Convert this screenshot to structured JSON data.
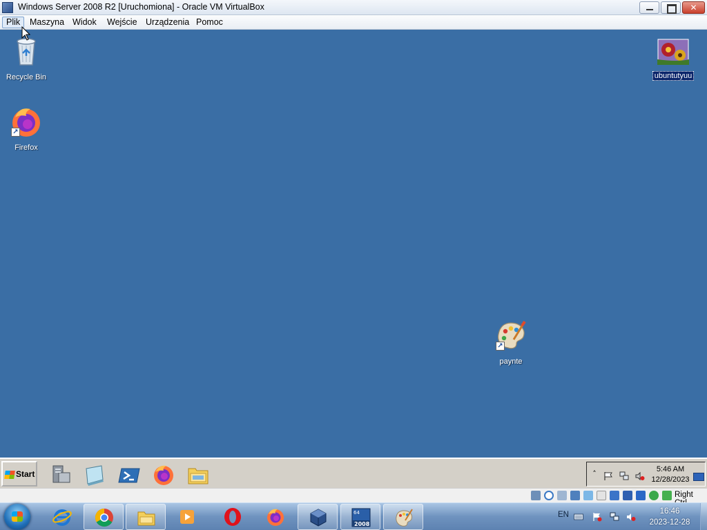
{
  "window": {
    "title": "Windows Server 2008 R2 [Uruchomiona] - Oracle VM VirtualBox",
    "icon": "virtualbox-icon"
  },
  "menu": {
    "items": [
      "Plik",
      "Maszyna",
      "Widok",
      "Wejście",
      "Urządzenia",
      "Pomoc"
    ],
    "active": "Plik"
  },
  "desktop": {
    "background_color": "#3a6ea5",
    "icons": {
      "recycle_bin": {
        "label": "Recycle Bin",
        "icon": "recycle-bin-icon"
      },
      "firefox": {
        "label": "Firefox",
        "icon": "firefox-icon"
      },
      "ubuntutyuu": {
        "label": "ubuntutyuu",
        "icon": "image-file-icon",
        "selected": true
      },
      "paynte": {
        "label": "paynte",
        "icon": "paint-palette-icon"
      }
    }
  },
  "guest_taskbar": {
    "start_label": "Start",
    "quicklaunch": [
      "server-manager-icon",
      "desktop-icon",
      "powershell-icon",
      "firefox-icon",
      "explorer-icon"
    ],
    "tray_icons": [
      "show-hidden-icon",
      "action-center-flag-icon",
      "network-icon",
      "volume-muted-icon"
    ],
    "time": "5:46 AM",
    "date": "12/28/2023"
  },
  "statusbar": {
    "icons": [
      "hard-disk-icon",
      "optical-drive-icon",
      "audio-icon",
      "network-icon",
      "usb-icon",
      "shared-folders-icon",
      "display-icon",
      "recording-icon",
      "vm-icon",
      "mouse-integration-icon",
      "keyboard-icon"
    ],
    "host_key": "Right Ctrl"
  },
  "host_taskbar": {
    "apps": [
      "internet-explorer-icon",
      "chrome-icon",
      "file-explorer-icon",
      "media-player-icon",
      "opera-icon",
      "firefox-icon",
      "virtualbox-icon",
      "windows-server-2008-icon",
      "paint-icon"
    ],
    "language": "EN",
    "tray_icons": [
      "keyboard-icon",
      "action-center-flag-icon",
      "network-icon",
      "volume-muted-icon"
    ],
    "time": "16:46",
    "date": "2023-12-28"
  }
}
